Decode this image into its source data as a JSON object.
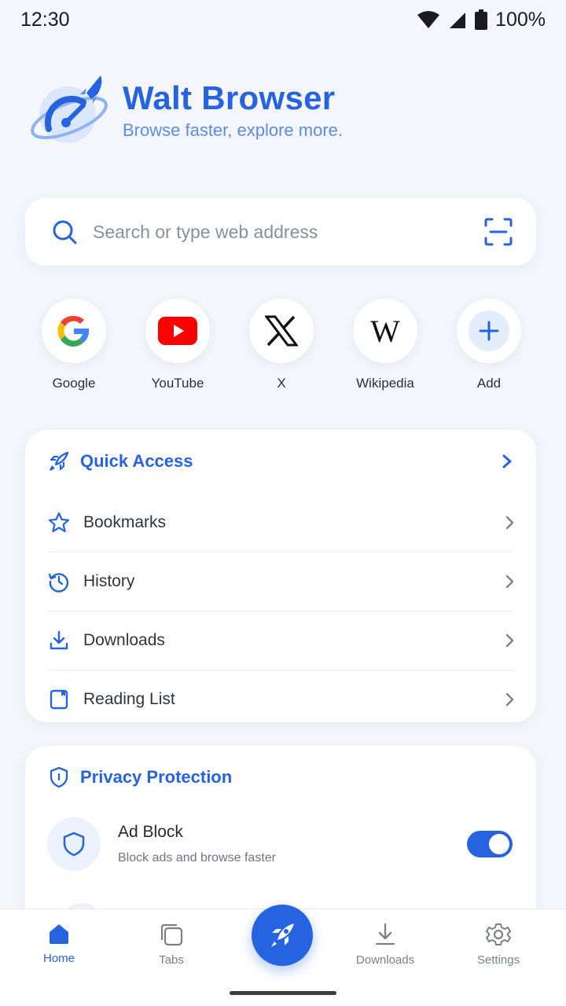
{
  "status": {
    "time": "12:30",
    "battery": "100%"
  },
  "brand": {
    "title": "Walt Browser",
    "tagline": "Browse faster, explore more."
  },
  "search": {
    "placeholder": "Search or type web address"
  },
  "shortcuts": [
    {
      "label": "Google"
    },
    {
      "label": "YouTube"
    },
    {
      "label": "X"
    },
    {
      "label": "Wikipedia"
    },
    {
      "label": "Add"
    }
  ],
  "quick_access": {
    "title": "Quick Access",
    "items": [
      {
        "label": "Bookmarks"
      },
      {
        "label": "History"
      },
      {
        "label": "Downloads"
      },
      {
        "label": "Reading List"
      }
    ]
  },
  "privacy": {
    "title": "Privacy Protection",
    "ad_block": {
      "title": "Ad Block",
      "subtitle": "Block ads and browse faster",
      "enabled": true
    }
  },
  "nav": {
    "home": "Home",
    "tabs": "Tabs",
    "downloads": "Downloads",
    "settings": "Settings"
  },
  "colors": {
    "accent": "#2563e0",
    "background": "#f4f6fb"
  }
}
